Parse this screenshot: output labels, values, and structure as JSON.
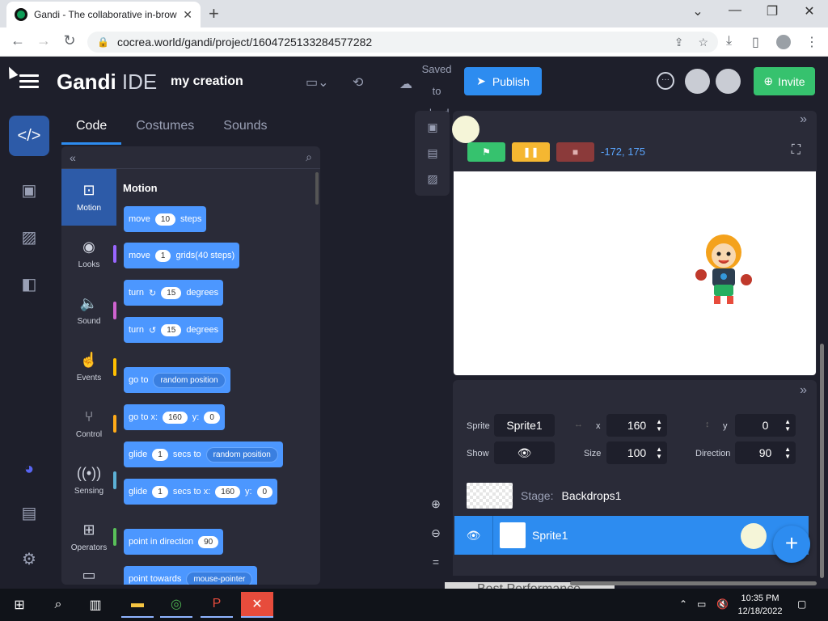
{
  "browser": {
    "tab_title": "Gandi - The collaborative in-brow",
    "new_tab": "+",
    "url": "cocrea.world/gandi/project/1604725133284577282",
    "controls": {
      "minimize": "⌄",
      "min": "—",
      "restore": "❐",
      "close": "✕"
    }
  },
  "header": {
    "logo_bold": "Gandi",
    "logo_light": " IDE",
    "project_name": "my creation",
    "save_line1": "Saved",
    "save_line2": "to",
    "save_line3": "cloud",
    "publish": "Publish",
    "invite": "Invite"
  },
  "code_tabs": {
    "code": "Code",
    "costumes": "Costumes",
    "sounds": "Sounds"
  },
  "categories": [
    {
      "label": "Motion",
      "color": "#4c97ff"
    },
    {
      "label": "Looks",
      "color": "#9966ff"
    },
    {
      "label": "Sound",
      "color": "#cf63cf"
    },
    {
      "label": "Events",
      "color": "#ffbf00"
    },
    {
      "label": "Control",
      "color": "#ffab19"
    },
    {
      "label": "Sensing",
      "color": "#5cb1d6"
    },
    {
      "label": "Operators",
      "color": "#59c059"
    }
  ],
  "palette": {
    "title": "Motion",
    "blocks": {
      "move_steps": {
        "a": "move",
        "v": "10",
        "b": "steps"
      },
      "move_grids": {
        "a": "move",
        "v": "1",
        "b": "grids(40 steps)"
      },
      "turn_right": {
        "a": "turn",
        "v": "15",
        "b": "degrees"
      },
      "turn_left": {
        "a": "turn",
        "v": "15",
        "b": "degrees"
      },
      "goto": {
        "a": "go to",
        "dd": "random position"
      },
      "goto_xy": {
        "a": "go to x:",
        "x": "160",
        "b": "y:",
        "y": "0"
      },
      "glide": {
        "a": "glide",
        "v": "1",
        "b": "secs to",
        "dd": "random position"
      },
      "glide_xy": {
        "a": "glide",
        "v": "1",
        "b": "secs to x:",
        "x": "160",
        "c": "y:",
        "y": "0"
      },
      "point_dir": {
        "a": "point in direction",
        "v": "90"
      },
      "point_towards": {
        "a": "point towards",
        "dd": "mouse-pointer"
      }
    }
  },
  "stage": {
    "coords": "-172, 175"
  },
  "sprite_info": {
    "sprite_label": "Sprite",
    "sprite_name": "Sprite1",
    "x_label": "x",
    "x": "160",
    "y_label": "y",
    "y": "0",
    "show_label": "Show",
    "size_label": "Size",
    "size": "100",
    "direction_label": "Direction",
    "direction": "90"
  },
  "sprite_list": {
    "stage_label": "Stage:",
    "stage_name": "Backdrops1",
    "sprite_name": "Sprite1"
  },
  "perf_hint": "Best Performance",
  "taskbar": {
    "time": "10:35 PM",
    "date": "12/18/2022"
  }
}
